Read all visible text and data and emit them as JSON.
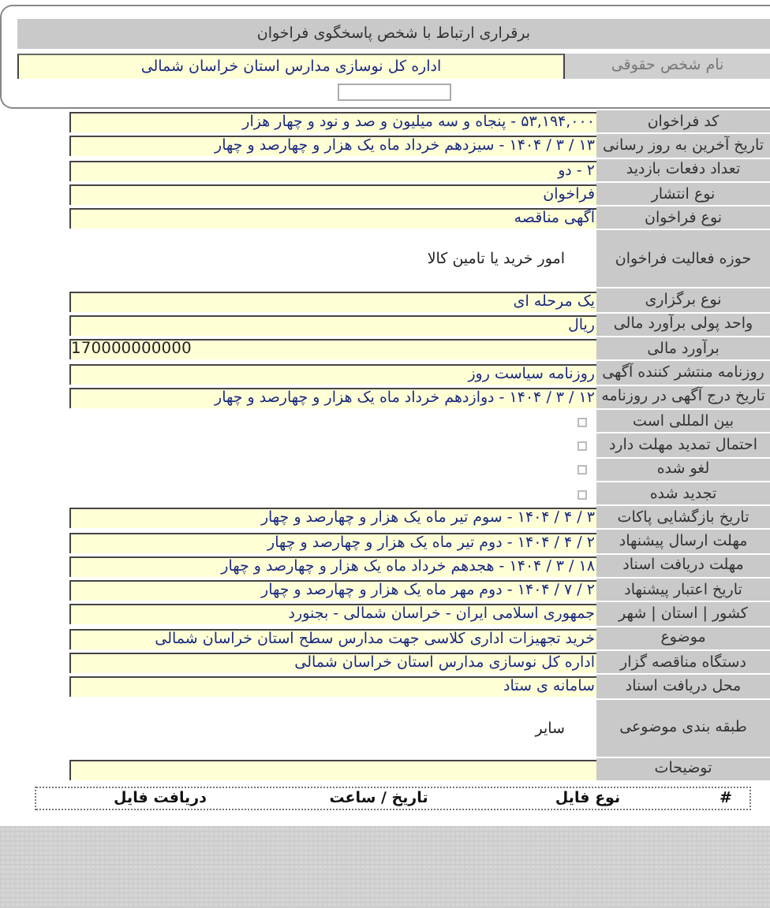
{
  "contact": {
    "title": "برقراری ارتباط با شخص پاسخگوی فراخوان",
    "label": "نام شخص حقوقی",
    "value": "اداره کل نوسازی مدارس استان خراسان شمالی"
  },
  "rows": [
    {
      "label": "کد فراخوان",
      "kind": "field",
      "value": "۵۳,۱۹۴,۰۰۰ - پنجاه و سه میلیون و صد و نود و چهار هزار"
    },
    {
      "label": "تاریخ آخرین به روز رسانی",
      "kind": "field",
      "value": "۱۳ / ۳ / ۱۴۰۴ - سیزدهم خرداد ماه یک هزار و چهارصد و چهار"
    },
    {
      "label": "تعداد دفعات بازدید",
      "kind": "field",
      "value": "۲ - دو"
    },
    {
      "label": "نوع انتشار",
      "kind": "field",
      "value": "فراخوان"
    },
    {
      "label": "نوع فراخوان",
      "kind": "field",
      "value": "آگهی مناقصه"
    },
    {
      "label": "حوزه فعالیت فراخوان",
      "kind": "text",
      "value": "امور خرید یا تامین کالا"
    },
    {
      "label": "نوع برگزاری",
      "kind": "field",
      "value": "یک مرحله ای"
    },
    {
      "label": "واحد پولی برآورد مالی",
      "kind": "field",
      "value": "ریال"
    },
    {
      "label": "برآورد مالی",
      "kind": "number",
      "value": "170000000000"
    },
    {
      "label": "روزنامه منتشر کننده آگهی",
      "kind": "field",
      "value": "روزنامه سیاست روز"
    },
    {
      "label": "تاریخ درج آگهی در روزنامه",
      "kind": "field",
      "value": "۱۲ / ۳ / ۱۴۰۴ - دوازدهم خرداد ماه یک هزار و چهارصد و چهار"
    },
    {
      "label": "بین المللی است",
      "kind": "checkbox",
      "checked": false
    },
    {
      "label": "احتمال تمدید مهلت دارد",
      "kind": "checkbox",
      "checked": false
    },
    {
      "label": "لغو شده",
      "kind": "checkbox",
      "checked": false
    },
    {
      "label": "تجدید شده",
      "kind": "checkbox",
      "checked": false
    },
    {
      "label": "تاریخ بازگشایی پاکات",
      "kind": "field",
      "value": "۳ / ۴ / ۱۴۰۴ - سوم تیر ماه یک هزار و چهارصد و چهار"
    },
    {
      "label": "مهلت ارسال پیشنهاد",
      "kind": "field",
      "value": "۲ / ۴ / ۱۴۰۴ - دوم تیر ماه یک هزار و چهارصد و چهار"
    },
    {
      "label": "مهلت دریافت اسناد",
      "kind": "field",
      "value": "۱۸ / ۳ / ۱۴۰۴ - هجدهم خرداد ماه یک هزار و چهارصد و چهار"
    },
    {
      "label": "تاریخ اعتبار پیشنهاد",
      "kind": "field",
      "value": "۲ / ۷ / ۱۴۰۴ - دوم مهر ماه یک هزار و چهارصد و چهار"
    },
    {
      "label": "کشور | استان | شهر",
      "kind": "field",
      "value": "جمهوری اسلامی ایران - خراسان شمالی - بجنورد"
    },
    {
      "label": "موضوع",
      "kind": "field",
      "value": "خرید تجهیزات اداری کلاسی جهت مدارس سطح استان خراسان شمالی"
    },
    {
      "label": "دستگاه مناقصه گزار",
      "kind": "field",
      "value": "اداره کل نوسازی مدارس استان خراسان شمالی"
    },
    {
      "label": "محل دریافت اسناد",
      "kind": "field",
      "value": "سامانه ی ستاد"
    },
    {
      "label": "طبقه بندی موضوعی",
      "kind": "text",
      "value": "سایر"
    },
    {
      "label": "توضیحات",
      "kind": "field"
    }
  ],
  "files_table": {
    "columns": [
      "#",
      "نوع فایل",
      "تاریخ / ساعت",
      "دریافت فایل"
    ]
  }
}
